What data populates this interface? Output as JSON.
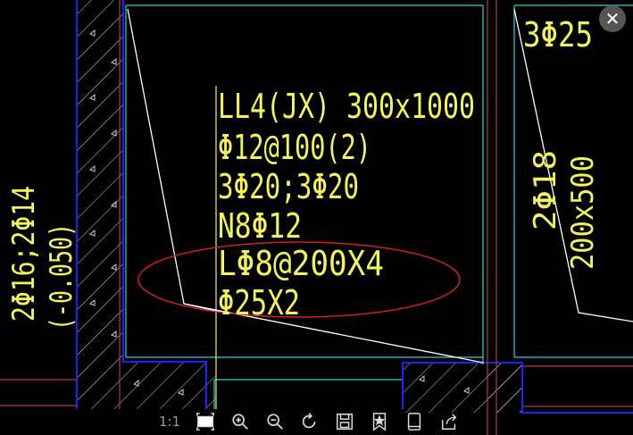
{
  "drawing": {
    "beam_label": "LL4(JX) 300x1000",
    "stirrup": "Φ12@100(2)",
    "main_bars": "3Φ20;3Φ20",
    "side_bars": "N8Φ12",
    "tie_bars": "LΦ8@200X4",
    "diag_bars": "Φ25X2",
    "right_top": "3Φ25",
    "right_vert_a": "2Φ18",
    "right_vert_b": "200x500",
    "left_vert_a": "2Φ16;2Φ14",
    "left_vert_b": "(-0.050)"
  },
  "toolbar": {
    "scale_label": "1:1",
    "items": [
      "fit-screen-icon",
      "zoom-in-icon",
      "zoom-out-icon",
      "rotate-icon",
      "save-icon",
      "favorite-icon",
      "device-icon",
      "share-icon"
    ]
  },
  "close_label": "✕",
  "colors": {
    "background": "#000000",
    "cad_text": "#f4f45a",
    "wall_outline": "#2020ff",
    "hatch": "#d8d8d8",
    "cyan_line": "#27d6d6",
    "red_line": "#b53b3b",
    "ellipse": "#d22020"
  }
}
